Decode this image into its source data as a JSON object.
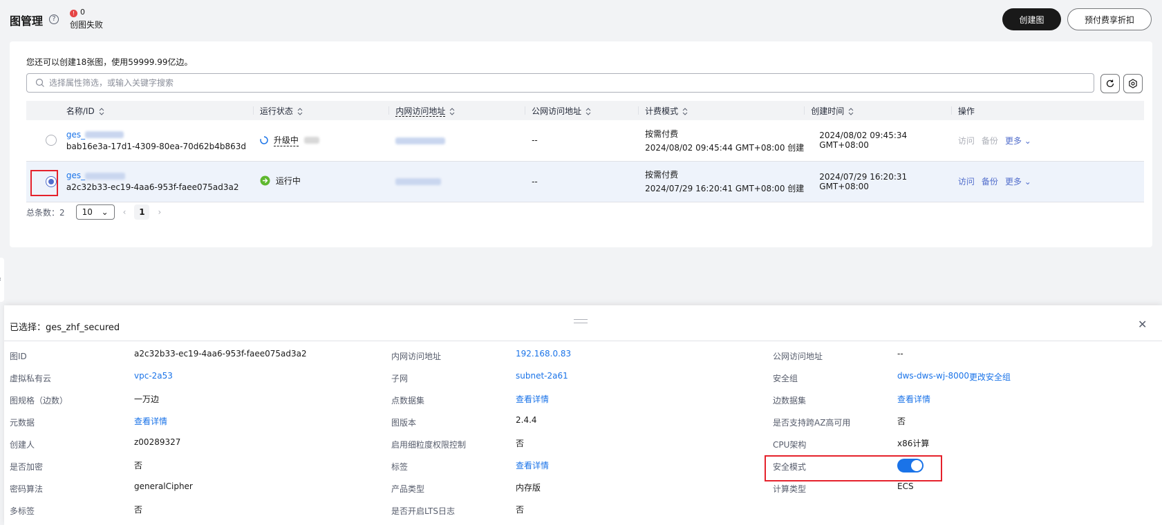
{
  "header": {
    "title": "图管理",
    "help_icon": "?",
    "failed_count": "0",
    "failed_label": "创图失败",
    "create_button": "创建图",
    "prepaid_button": "预付费享折扣"
  },
  "list": {
    "quota_text": "您还可以创建18张图，使用59999.99亿边。",
    "search_placeholder": "选择属性筛选，或输入关键字搜索",
    "columns": [
      "名称/ID",
      "运行状态",
      "内网访问地址",
      "公网访问地址",
      "计费模式",
      "创建时间",
      "操作"
    ],
    "rows": [
      {
        "name_prefix": "ges_",
        "id": "bab16e3a-17d1-4309-80ea-70d62b4b863d",
        "status": "升级中",
        "public_ip": "--",
        "billing": "按需付费",
        "billing_time": "2024/08/02 09:45:44 GMT+08:00 创建",
        "created": "2024/08/02 09:45:34 GMT+08:00",
        "op_visit": "访问",
        "op_backup": "备份",
        "op_more": "更多"
      },
      {
        "name_prefix": "ges_",
        "id": "a2c32b33-ec19-4aa6-953f-faee075ad3a2",
        "status": "运行中",
        "public_ip": "--",
        "billing": "按需付费",
        "billing_time": "2024/07/29 16:20:41 GMT+08:00 创建",
        "created": "2024/07/29 16:20:31 GMT+08:00",
        "op_visit": "访问",
        "op_backup": "备份",
        "op_more": "更多"
      }
    ],
    "total_label": "总条数：2",
    "page_size": "10",
    "current_page": "1"
  },
  "detail": {
    "title": "已选择：ges_zhf_secured",
    "col1": [
      {
        "label": "图ID",
        "value": "a2c32b33-ec19-4aa6-953f-faee075ad3a2"
      },
      {
        "label": "虚拟私有云",
        "value": "vpc-2a53"
      },
      {
        "label": "图规格（边数）",
        "value": "一万边"
      },
      {
        "label": "元数据",
        "value": "查看详情"
      },
      {
        "label": "创建人",
        "value": "z00289327"
      },
      {
        "label": "是否加密",
        "value": "否"
      },
      {
        "label": "密码算法",
        "value": "generalCipher"
      },
      {
        "label": "多标签",
        "value": "否"
      }
    ],
    "col2": [
      {
        "label": "内网访问地址",
        "value": "192.168.0.83"
      },
      {
        "label": "子网",
        "value": "subnet-2a61"
      },
      {
        "label": "点数据集",
        "value": "查看详情"
      },
      {
        "label": "图版本",
        "value": "2.4.4"
      },
      {
        "label": "启用细粒度权限控制",
        "value": "否"
      },
      {
        "label": "标签",
        "value": "查看详情"
      },
      {
        "label": "产品类型",
        "value": "内存版"
      },
      {
        "label": "是否开启LTS日志",
        "value": "否"
      }
    ],
    "col3": [
      {
        "label": "公网访问地址",
        "value": "--"
      },
      {
        "label": "安全组",
        "value": "dws-dws-wj-8000",
        "extra": "更改安全组"
      },
      {
        "label": "边数据集",
        "value": "查看详情"
      },
      {
        "label": "是否支持跨AZ高可用",
        "value": "否"
      },
      {
        "label": "CPU架构",
        "value": "x86计算"
      },
      {
        "label": "安全模式",
        "value": ""
      },
      {
        "label": "计算类型",
        "value": "ECS"
      }
    ],
    "security_mode_on": true
  }
}
